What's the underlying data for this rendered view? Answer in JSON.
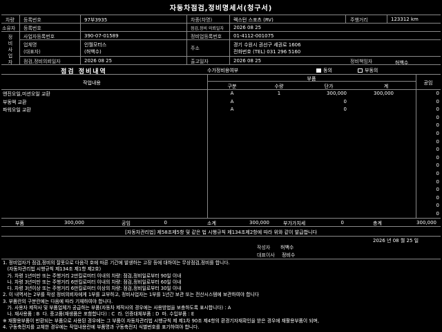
{
  "title": "자동차점검,정비명세서(청구서)",
  "header": {
    "left_group_label_top": "차량",
    "left_group_label_owner": "소유자",
    "row1": {
      "l1": "등록번호",
      "v1": "97부3935",
      "l2": "차종(차명)",
      "v2": "렉스턴 스포츠 (RV)",
      "l3": "주행거리",
      "v3": "123312 km"
    },
    "row2": {
      "l1": "등록번호",
      "v1": "",
      "l2": "점검,정비 의뢰일자",
      "v2": "2026 08 25"
    },
    "side_label": [
      "정",
      "비",
      "사",
      "업",
      "자"
    ],
    "row3": {
      "l1": "사업자등록번호",
      "v1": "390-07-01589",
      "l2": "정비업등록번호",
      "v2": "01-4112-001075"
    },
    "row4": {
      "l1a": "업체명",
      "l1b": "(대표자)",
      "v1a": "인월모터스",
      "v1b": "(허백수)",
      "l2": "주소",
      "v2a": "경기 수원시 권선구 세권로 1606",
      "v2b": "전화번호 (TEL) 031 296 5160"
    },
    "row5": {
      "l1": "점검,정비의뢰일자",
      "v1": "2026 08 25",
      "l2": "출고일자",
      "v2": "2026 08 25",
      "l3": "정비책임자",
      "v3": "허백수"
    }
  },
  "section": {
    "title": "점검 정비내역",
    "parts_label": "수가정비용여부",
    "check_on_label": "동의",
    "check_off_label": "부동의"
  },
  "table_head": {
    "item": "작업내용",
    "parts": "부품",
    "kind": "구분",
    "qty": "수량",
    "unit": "단가",
    "amount": "계",
    "labor": "공임"
  },
  "rows": [
    {
      "item": "엔진오일,미션오일 교환",
      "kind": "A",
      "qty": "1",
      "unit": "300,000",
      "amount": "300,000",
      "labor": "0"
    },
    {
      "item": "부동액 교환",
      "kind": "A",
      "qty": "",
      "unit": "0",
      "amount": "",
      "labor": "0"
    },
    {
      "item": "파워오일 교환",
      "kind": "A",
      "qty": "",
      "unit": "0",
      "amount": "",
      "labor": "0"
    },
    {
      "item": "",
      "kind": "",
      "qty": "",
      "unit": "",
      "amount": "",
      "labor": "0"
    },
    {
      "item": "",
      "kind": "",
      "qty": "",
      "unit": "",
      "amount": "",
      "labor": "0"
    },
    {
      "item": "",
      "kind": "",
      "qty": "",
      "unit": "",
      "amount": "",
      "labor": "0"
    },
    {
      "item": "",
      "kind": "",
      "qty": "",
      "unit": "",
      "amount": "",
      "labor": "0"
    },
    {
      "item": "",
      "kind": "",
      "qty": "",
      "unit": "",
      "amount": "",
      "labor": "0"
    },
    {
      "item": "",
      "kind": "",
      "qty": "",
      "unit": "",
      "amount": "",
      "labor": "0"
    },
    {
      "item": "",
      "kind": "",
      "qty": "",
      "unit": "",
      "amount": "",
      "labor": "0"
    },
    {
      "item": "",
      "kind": "",
      "qty": "",
      "unit": "",
      "amount": "",
      "labor": "0"
    },
    {
      "item": "",
      "kind": "",
      "qty": "",
      "unit": "",
      "amount": "",
      "labor": "0"
    },
    {
      "item": "",
      "kind": "",
      "qty": "",
      "unit": "",
      "amount": "",
      "labor": "0"
    },
    {
      "item": "",
      "kind": "",
      "qty": "",
      "unit": "",
      "amount": "",
      "labor": "0"
    },
    {
      "item": "",
      "kind": "",
      "qty": "",
      "unit": "",
      "amount": "",
      "labor": "0"
    },
    {
      "item": "",
      "kind": "",
      "qty": "",
      "unit": "",
      "amount": "",
      "labor": "0"
    }
  ],
  "totals": {
    "parts_label": "부품",
    "parts_value": "300,000",
    "labor_label": "공임",
    "labor_value": "0",
    "subtotal_label": "소계",
    "subtotal_value": "300,000",
    "vat_label": "부가가치세",
    "vat_value": "0",
    "total_label": "총계",
    "total_value": "300,000"
  },
  "notice": "[자동차관리법] 제58조제5항 및 같은 법 시행규칙 제134조제2항에 따라 위와 같이 발급합니다",
  "date": "2026 년 08 월 25 일",
  "signer1": {
    "label": "작성자",
    "name": "허백수"
  },
  "signer2": {
    "label": "대표이사",
    "name": "정비수"
  },
  "footer_lines": [
    "1. 정비업자가 점검,정비의 잘못으로 다음각 호에 따른 기간에 발생하는 고장 등에 대하여는 무상점검,정비를 합니다.",
    "   (자동차관리법 시행규칙 제134조 제1항 제2호)",
    "   가. 차령 1년미만 또는 주행거리 2만킬로미터 이내의 차량: 점검,정비일로부터 90일 이내",
    "   나. 차령 3년미만 또는 주행거리 6만킬로미터 이내의 차량: 점검,정비일로부터 60일 이내",
    "   다. 차령 3년이상 또는 주행거리 6만킬로미터 이상의 차량: 점검,정비일로부터 30일 이내",
    "2. 이 내역서는 2부를 작성 정비의뢰자에게 1부를 교부하고, 정비사업자는 1부를 1년간 보관 또는 전산시스템에 보관하여야 합니다",
    "3. 부품란의 구분란에는 다음에 따라 기재하여야 합니다.",
    "   가. 사용자 제작사 및 부품업체가 공급하는 부품(자동차 제작사의 경우에는 사용방법을 보충하도록 표시합니다) : A",
    "   나. 재사용품 : B  다. 중고품(재생품은 포함합니다) : C  라. 인증대체부품 : D  마. 수입부품 : E",
    "※ 재활용부품이 반환되는 부품으로 사용된 경우에는 그 부품이 자동차관리법 시행규칙 제 제1차 90조 제4항의 환경기자재확인을 받은 경우에 재활용부품이 되며,",
    "4. 구동축전지를 교체한 경우에는 작업내용란에 부품명과 구동축전지 식별번호를 표기하여야 합니다."
  ]
}
